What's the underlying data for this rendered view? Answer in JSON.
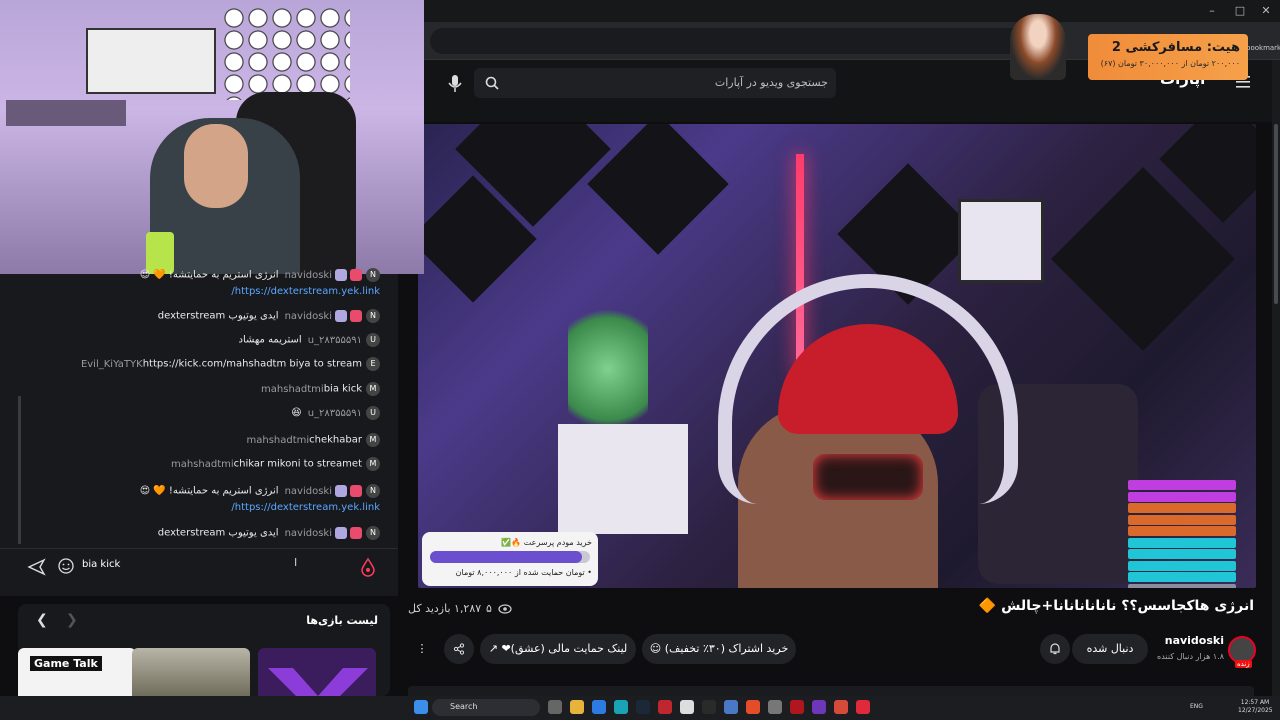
{
  "browser": {
    "bookmarks_label": "bookmarks",
    "controls": [
      "–",
      "□",
      "✕"
    ]
  },
  "aparat": {
    "logo": "آپارات",
    "search_placeholder": "جستجوی ویدیو در آپارات"
  },
  "video": {
    "title": "انرژی هاکجاسس؟؟ نانانانانانا+چالش 🔶",
    "views": "۱,۲۸۷ بازدید کل",
    "likes": "۵",
    "donation_title": "خرید مودم پرسرعت 🔥✅",
    "donation_sub": "• تومان حمایت شده از ۸,۰۰۰,۰۰۰ تومان",
    "donation_progress": 0.95
  },
  "channel": {
    "name": "navidoski",
    "followers": "۱.۸ هزار دنبال کننده",
    "live_badge": "زنده",
    "follow_label": "دنبال شده",
    "subscribe_label": "خرید اشتراک (۳۰٪ تخفیف)",
    "donate_label": "لینک حمایت مالی (عشق)❤"
  },
  "chat": {
    "messages": [
      {
        "user": "navidoski",
        "text": "انرژی استریم به حمایتشه! 🧡 😍",
        "badges": true,
        "avatar": "N"
      },
      {
        "user": "",
        "text": "https://dexterstream.yek.link/",
        "link": true
      },
      {
        "user": "navidoski",
        "text": "ایدی یوتیوب dexterstream",
        "badges": true,
        "avatar": "N"
      },
      {
        "user": "u_۲۸۳۵۵۵۹۱",
        "text": "استریمه مهشاد",
        "avatar": "U"
      },
      {
        "user": "Evil_KiYaTYK",
        "text": "https://kick.com/mahshadtm biya to stream",
        "avatar": "E"
      },
      {
        "user": "mahshadtmi",
        "text": "bia kick",
        "avatar": "M"
      },
      {
        "user": "u_۲۸۳۵۵۵۹۱",
        "text": "😆",
        "avatar": "U"
      },
      {
        "user": "mahshadtmi",
        "text": "chekhabar",
        "avatar": "M"
      },
      {
        "user": "mahshadtmi",
        "text": "chikar mikoni to streamet",
        "avatar": "M"
      },
      {
        "user": "navidoski",
        "text": "انرژی استریم به حمایتشه! 🧡 😍",
        "badges": true,
        "avatar": "N"
      },
      {
        "user": "",
        "text": "https://dexterstream.yek.link/",
        "link": true
      },
      {
        "user": "navidoski",
        "text": "ایدی یوتیوب dexterstream",
        "badges": true,
        "avatar": "N"
      }
    ],
    "input_value": "bia kick"
  },
  "games": {
    "title": "لیست بازی‌ها",
    "cards": [
      {
        "label": "Game Talk"
      },
      {
        "label": ""
      },
      {
        "label": ""
      }
    ]
  },
  "alert": {
    "title": "هیت: مسافرکشی 2",
    "sub": "۲۰۰,۰۰۰ تومان از ۳۰,۰۰۰,۰۰۰ تومان (۶۷)"
  },
  "overlay_list": [
    {
      "text": "",
      "color": "#c03de0"
    },
    {
      "text": "",
      "color": "#c03de0"
    },
    {
      "text": "",
      "color": "#d96a2c"
    },
    {
      "text": "",
      "color": "#d96a2c"
    },
    {
      "text": "",
      "color": "#d96a2c"
    },
    {
      "text": "",
      "color": "#20c6d6"
    },
    {
      "text": "",
      "color": "#20c6d6"
    },
    {
      "text": "",
      "color": "#20c6d6"
    },
    {
      "text": "",
      "color": "#20c6d6"
    },
    {
      "text": "",
      "color": "#8c8ca0"
    }
  ],
  "taskbar": {
    "search_label": "Search",
    "lang": "ENG",
    "time": "12:57 AM",
    "date": "12/27/2025"
  }
}
